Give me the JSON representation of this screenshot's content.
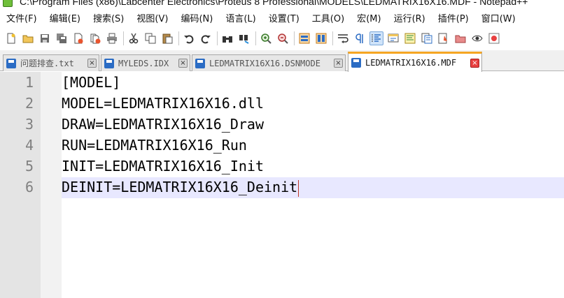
{
  "window": {
    "title": "C:\\Program Files (x86)\\Labcenter Electronics\\Proteus 8 Professional\\MODELS\\LEDMATRIX16X16.MDF - Notepad++"
  },
  "menu": [
    "文件(F)",
    "编辑(E)",
    "搜索(S)",
    "视图(V)",
    "编码(N)",
    "语言(L)",
    "设置(T)",
    "工具(O)",
    "宏(M)",
    "运行(R)",
    "插件(P)",
    "窗口(W)"
  ],
  "tabs": [
    {
      "label": "问题排查.txt",
      "active": false
    },
    {
      "label": "MYLEDS.IDX",
      "active": false
    },
    {
      "label": "LEDMATRIX16X16.DSNMODE",
      "active": false
    },
    {
      "label": "LEDMATRIX16X16.MDF",
      "active": true
    }
  ],
  "tab_close_glyph": "×",
  "editor": {
    "lines": [
      {
        "number": "1",
        "text": "[MODEL]"
      },
      {
        "number": "2",
        "text": "MODEL=LEDMATRIX16X16.dll"
      },
      {
        "number": "3",
        "text": "DRAW=LEDMATRIX16X16_Draw"
      },
      {
        "number": "4",
        "text": "RUN=LEDMATRIX16X16_Run"
      },
      {
        "number": "5",
        "text": "INIT=LEDMATRIX16X16_Init"
      },
      {
        "number": "6",
        "text": "DEINIT=LEDMATRIX16X16_Deinit"
      }
    ],
    "current_line": 6
  },
  "colors": {
    "current_line_bg": "#e8e8ff",
    "active_tab_accent": "#f5a623",
    "caret": "#c0392b"
  }
}
